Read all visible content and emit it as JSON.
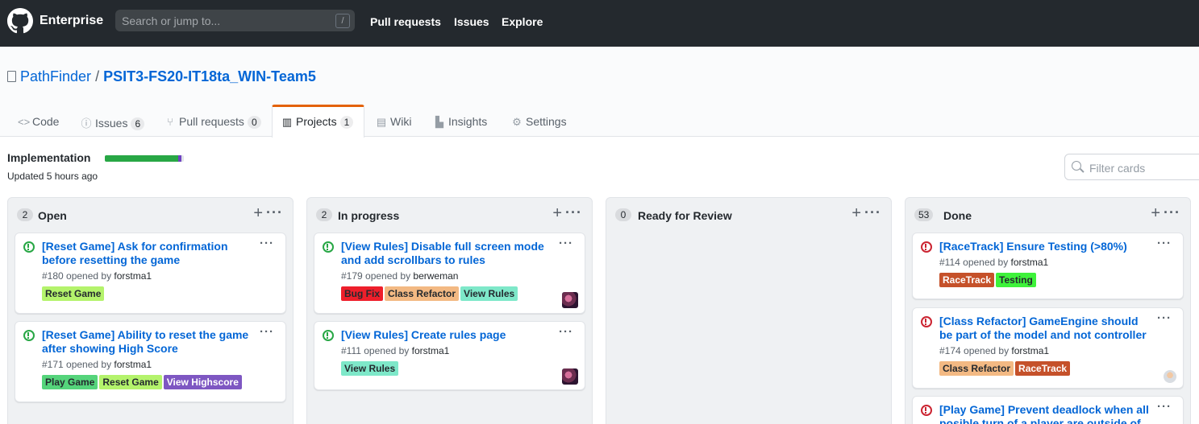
{
  "header": {
    "brand": "Enterprise",
    "search_placeholder": "Search or jump to...",
    "search_key": "/",
    "nav": [
      "Pull requests",
      "Issues",
      "Explore"
    ]
  },
  "repo": {
    "owner": "PathFinder",
    "separator": "/",
    "name": "PSIT3-FS20-IT18ta_WIN-Team5"
  },
  "tabs": [
    {
      "label": "Code",
      "icon": "code-icon",
      "count": null
    },
    {
      "label": "Issues",
      "icon": "issue-icon",
      "count": "6"
    },
    {
      "label": "Pull requests",
      "icon": "pull-request-icon",
      "count": "0"
    },
    {
      "label": "Projects",
      "icon": "project-icon",
      "count": "1",
      "selected": true
    },
    {
      "label": "Wiki",
      "icon": "book-icon",
      "count": null
    },
    {
      "label": "Insights",
      "icon": "graph-icon",
      "count": null
    },
    {
      "label": "Settings",
      "icon": "gear-icon",
      "count": null
    }
  ],
  "project": {
    "title": "Implementation",
    "updated": "Updated 5 hours ago",
    "filter_placeholder": "Filter cards",
    "progress": {
      "done_fraction": 0.93,
      "in_progress_fraction": 0.04,
      "done_color": "#28a745",
      "in_progress_color": "#6f42c1"
    }
  },
  "columns": [
    {
      "count": "2",
      "name": "Open",
      "cards": [
        {
          "status": "open",
          "title": "[Reset Game] Ask for confirmation before resetting the game",
          "number": "#180",
          "opened_by": "opened by",
          "user": "forstma1",
          "labels": [
            {
              "text": "Reset Game",
              "bg": "#b4f36c",
              "fg": "#24292e"
            }
          ],
          "avatar": null
        },
        {
          "status": "open",
          "title": "[Reset Game] Ability to reset the game after showing High Score",
          "number": "#171",
          "opened_by": "opened by",
          "user": "forstma1",
          "labels": [
            {
              "text": "Play Game",
              "bg": "#55d47b",
              "fg": "#24292e"
            },
            {
              "text": "Reset Game",
              "bg": "#b4f36c",
              "fg": "#24292e"
            },
            {
              "text": "View Highscore",
              "bg": "#7e57c2",
              "fg": "#ffffff"
            }
          ],
          "avatar": null
        }
      ]
    },
    {
      "count": "2",
      "name": "In progress",
      "cards": [
        {
          "status": "open",
          "title": "[View Rules] Disable full screen mode and add scrollbars to rules",
          "number": "#179",
          "opened_by": "opened by",
          "user": "berweman",
          "labels": [
            {
              "text": "Bug Fix",
              "bg": "#ee1f2b",
              "fg": "#24292e"
            },
            {
              "text": "Class Refactor",
              "bg": "#f3b983",
              "fg": "#24292e"
            },
            {
              "text": "View Rules",
              "bg": "#7ee8c9",
              "fg": "#24292e"
            }
          ],
          "avatar": "a1"
        },
        {
          "status": "open",
          "title": "[View Rules] Create rules page",
          "number": "#111",
          "opened_by": "opened by",
          "user": "forstma1",
          "labels": [
            {
              "text": "View Rules",
              "bg": "#7ee8c9",
              "fg": "#24292e"
            }
          ],
          "avatar": "a1"
        }
      ]
    },
    {
      "count": "0",
      "name": "Ready for Review",
      "cards": []
    },
    {
      "count": "53",
      "name": "Done",
      "cards": [
        {
          "status": "closed",
          "title": "[RaceTrack] Ensure Testing (>80%)",
          "number": "#114",
          "opened_by": "opened by",
          "user": "forstma1",
          "labels": [
            {
              "text": "RaceTrack",
              "bg": "#c5512a",
              "fg": "#ffffff"
            },
            {
              "text": "Testing",
              "bg": "#3ef23a",
              "fg": "#24292e"
            }
          ],
          "avatar": null
        },
        {
          "status": "closed",
          "title": "[Class Refactor] GameEngine should be part of the model and not controller",
          "number": "#174",
          "opened_by": "opened by",
          "user": "forstma1",
          "labels": [
            {
              "text": "Class Refactor",
              "bg": "#f3b983",
              "fg": "#24292e"
            },
            {
              "text": "RaceTrack",
              "bg": "#c5512a",
              "fg": "#ffffff"
            }
          ],
          "avatar": "a2"
        },
        {
          "status": "closed",
          "title": "[Play Game] Prevent deadlock when all posible turn of a player are outside of",
          "number": "",
          "opened_by": "",
          "user": "",
          "labels": [],
          "avatar": null
        }
      ]
    }
  ]
}
